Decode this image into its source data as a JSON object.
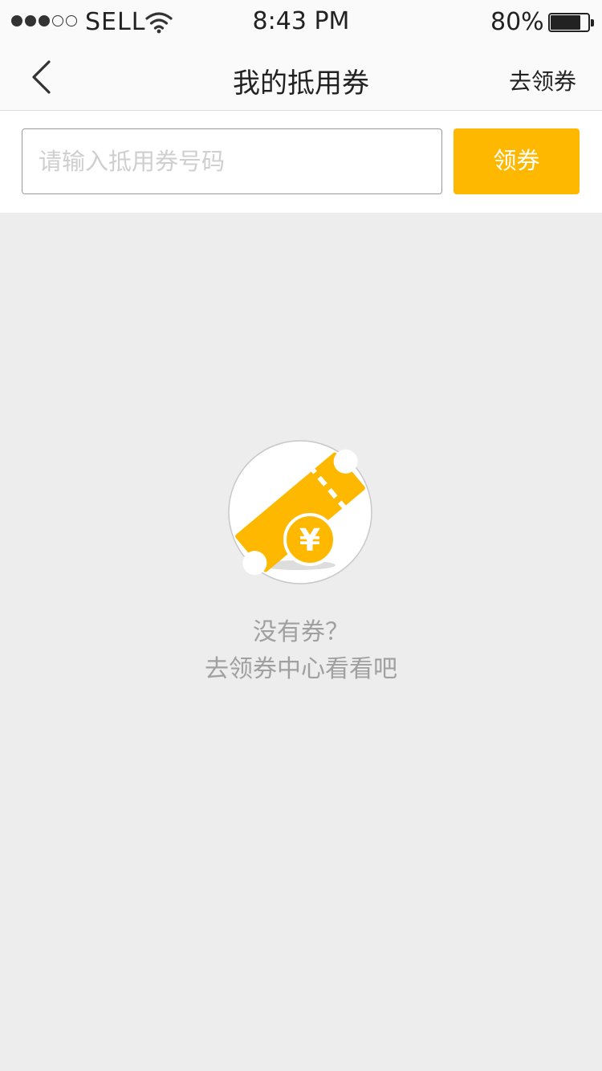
{
  "status_bar": {
    "carrier": "SELL",
    "time": "8:43 PM",
    "battery": "80%",
    "battery_level": 0.8,
    "signal_strength": 3,
    "signal_max": 5
  },
  "nav": {
    "title": "我的抵用券",
    "action": "去领券",
    "back_icon": "chevron-left-icon"
  },
  "coupon_form": {
    "placeholder": "请输入抵用券号码",
    "value": "",
    "button": "领券"
  },
  "empty_state": {
    "icon": "coupon-yen-icon",
    "yen_symbol": "¥",
    "line1": "没有券？",
    "line2": "去领券中心看看吧"
  },
  "colors": {
    "accent": "#ffb800",
    "background": "#ededed",
    "empty_text": "#a0a0a0"
  }
}
